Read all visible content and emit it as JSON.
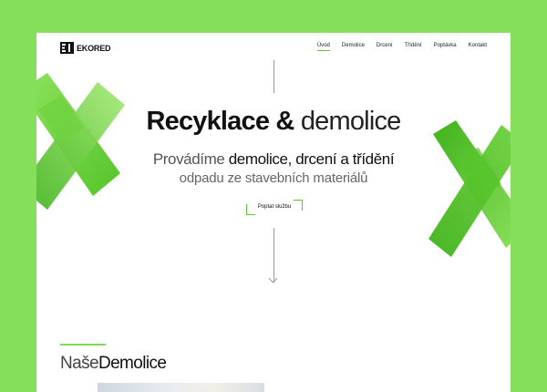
{
  "header": {
    "logo_text": "EKORED",
    "nav": [
      "Úvod",
      "Demolice",
      "Drcení",
      "Třídění",
      "Poptávka",
      "Kontakt"
    ]
  },
  "hero": {
    "title_bold": "Recyklace &",
    "title_light": "demolice",
    "sub1_light": "Provádíme",
    "sub1_bold": "demolice, drcení a třídění",
    "sub2": "odpadu ze stavebních materiálů",
    "cta_label": "Poptat službu"
  },
  "section": {
    "title_light": "Naše",
    "title_bold": "Demolice"
  },
  "colors": {
    "background": "#86df5a",
    "accent": "#5cc532",
    "deco_dark": "#3fb21b",
    "deco_light": "#8fe25e"
  },
  "icons": [
    "logo-mark-icon",
    "arrow-down-icon",
    "x-decoration-left",
    "x-decoration-right"
  ]
}
